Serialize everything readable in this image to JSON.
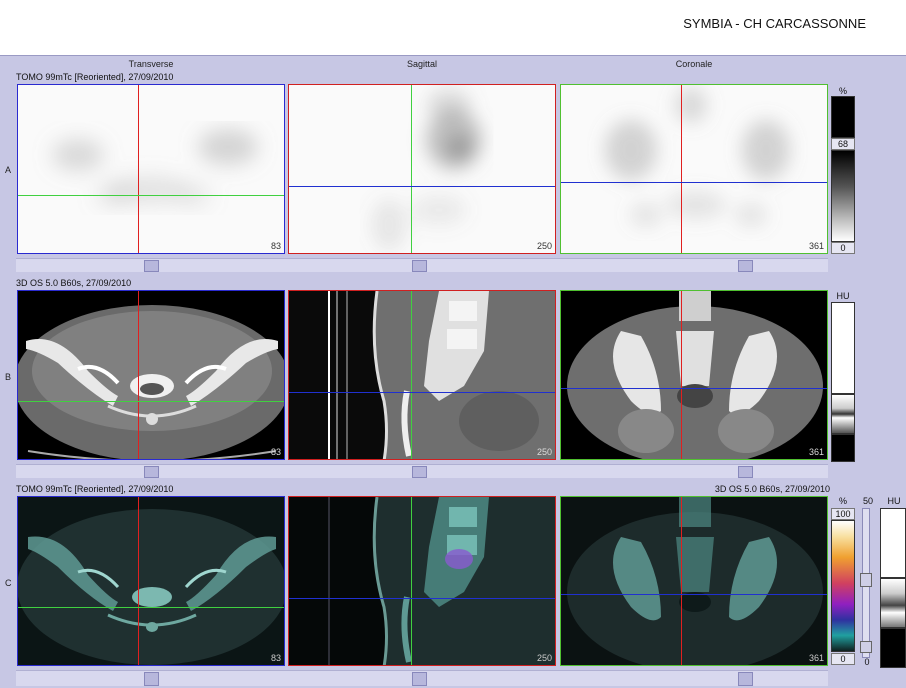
{
  "header": {
    "site": "SYMBIA - CH CARCASSONNE"
  },
  "columns": {
    "transverse": "Transverse",
    "sagittal": "Sagittal",
    "coronal": "Coronale"
  },
  "rows": {
    "a": {
      "letter": "A",
      "caption": "TOMO 99mTc [Reoriented], 27/09/2010"
    },
    "b": {
      "letter": "B",
      "caption": "3D  OS  5.0  B60s, 27/09/2010"
    },
    "c": {
      "letter": "C",
      "caption_left": "TOMO 99mTc [Reoriented], 27/09/2010",
      "caption_right": "3D  OS  5.0  B60s, 27/09/2010"
    }
  },
  "slices": {
    "transverse": "83",
    "sagittal": "250",
    "coronal": "361"
  },
  "scales": {
    "a": {
      "unit": "%",
      "max": "68",
      "min": "0"
    },
    "b": {
      "unit": "HU"
    },
    "c": {
      "unit_left": "%",
      "max": "100",
      "min": "0",
      "window_value": "50",
      "window_min": "0",
      "unit_right": "HU"
    }
  },
  "colors": {
    "crosshair_red": "#e02020",
    "crosshair_green": "#40d040",
    "crosshair_blue": "#2030d0",
    "background": "#c7c7e4"
  }
}
